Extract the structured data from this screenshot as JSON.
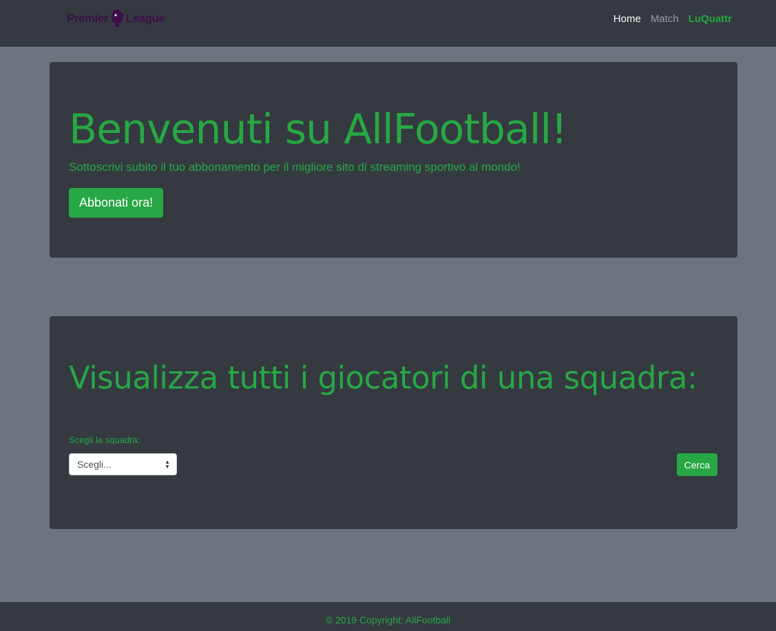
{
  "navbar": {
    "brand_left": "Premier",
    "brand_right": "League",
    "links": {
      "home": "Home",
      "match": "Match",
      "user": "LuQuattr"
    }
  },
  "hero": {
    "title": "Benvenuti su AllFootball!",
    "subtitle": "Sottoscrivi subito il tuo abbonamento per il migliore sito di streaming sportivo al mondo!",
    "cta_label": "Abbonati ora!"
  },
  "team_search": {
    "title": "Visualizza tutti i giocatori di una squadra:",
    "label": "Scegli la squadra:",
    "select_value": "Scegli...",
    "button_label": "Cerca"
  },
  "footer": {
    "text": "© 2019 Copyright: AllFootball"
  },
  "colors": {
    "accent": "#28a745",
    "dark": "#343a40",
    "background": "#6c757d",
    "brand": "#3d0f4a"
  },
  "icons": {
    "brand_logo": "premier-league-lion-logo",
    "select_arrows": "sort-arrows-icon"
  }
}
